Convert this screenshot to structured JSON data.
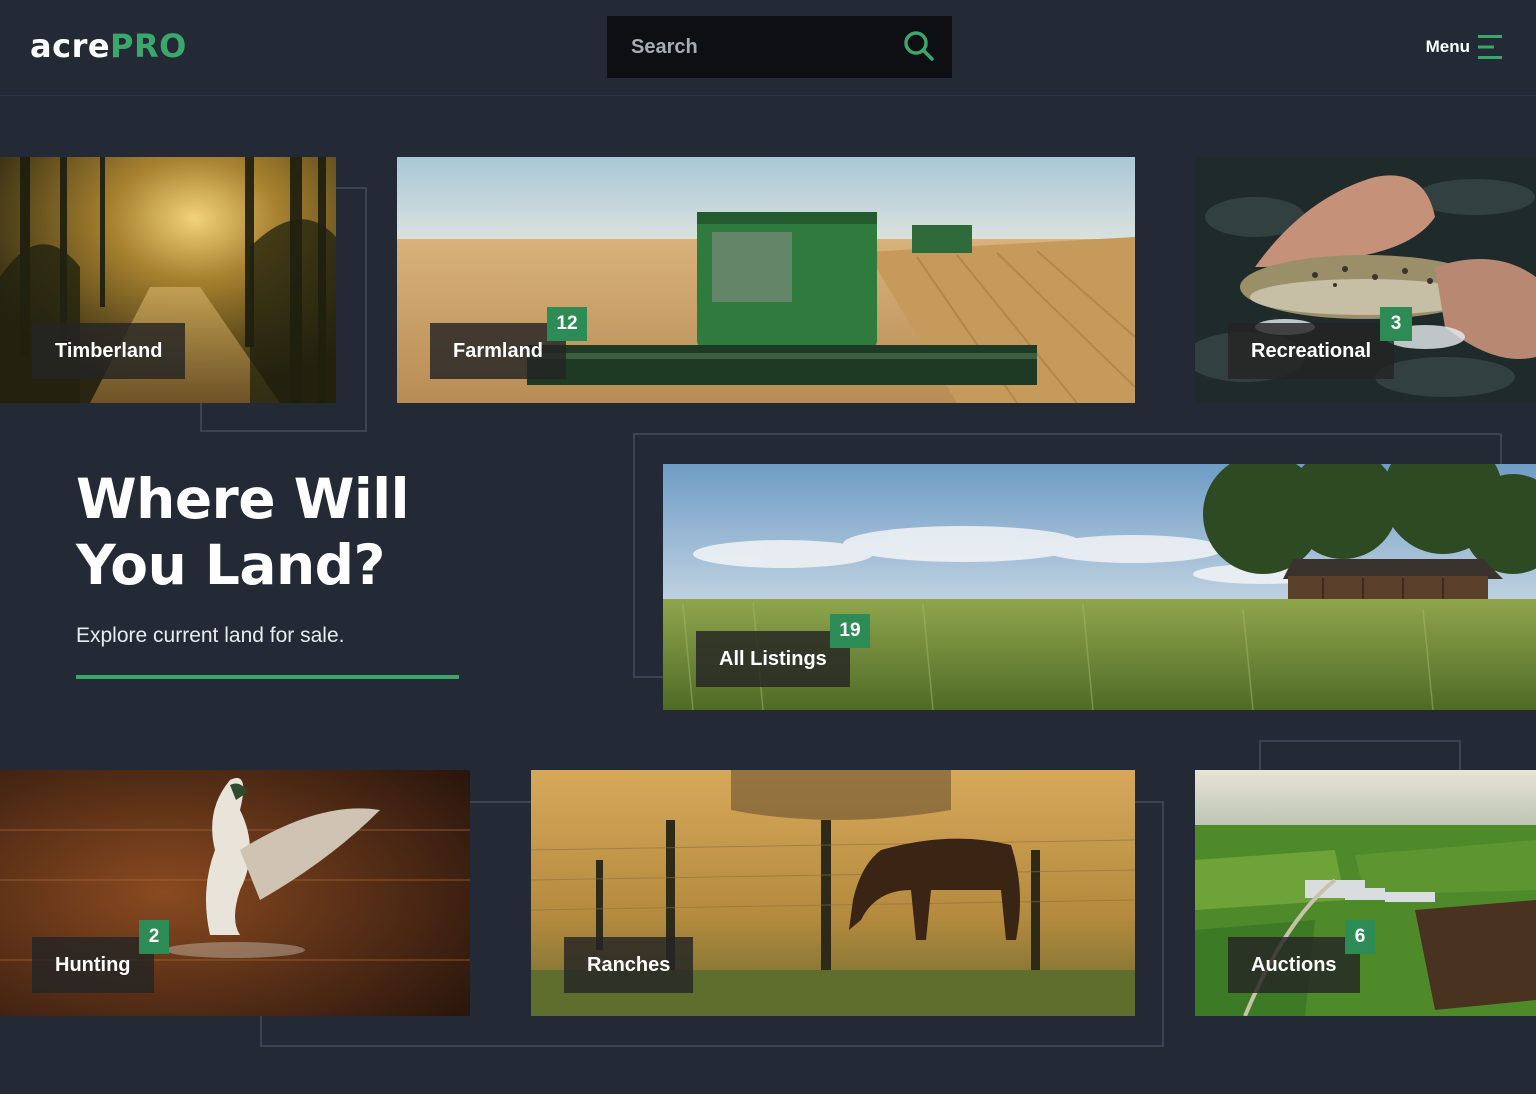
{
  "header": {
    "logo_main": "acre",
    "logo_accent": "PRO",
    "search_placeholder": "Search",
    "menu_label": "Menu"
  },
  "hero": {
    "title_line1": "Where Will",
    "title_line2": "You Land?",
    "subtitle": "Explore current land for sale."
  },
  "categories": [
    {
      "label": "Timberland",
      "count": null
    },
    {
      "label": "Farmland",
      "count": "12"
    },
    {
      "label": "Recreational",
      "count": "3"
    },
    {
      "label": "All Listings",
      "count": "19"
    },
    {
      "label": "Hunting",
      "count": "2"
    },
    {
      "label": "Ranches",
      "count": null
    },
    {
      "label": "Auctions",
      "count": "6"
    }
  ],
  "colors": {
    "background": "#232a35",
    "accent": "#3aa86b",
    "badge": "#2d8c55",
    "search_bg": "#0d0f12"
  }
}
